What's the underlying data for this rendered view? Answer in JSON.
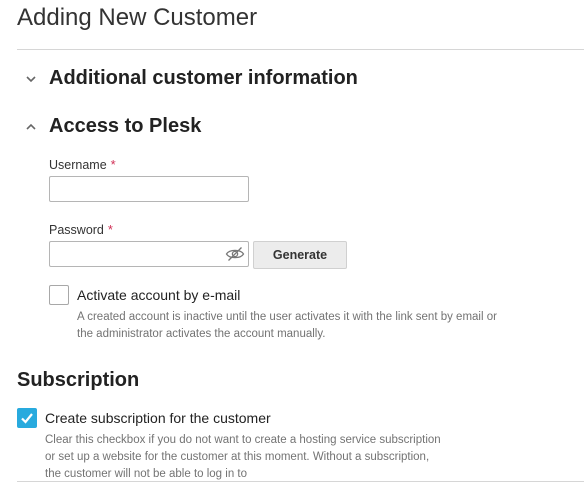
{
  "page": {
    "title": "Adding New Customer"
  },
  "sections": {
    "additional": {
      "label": "Additional customer information",
      "expanded": false,
      "icon": "chevron-down-icon"
    },
    "access": {
      "label": "Access to Plesk",
      "expanded": true,
      "icon": "chevron-up-icon"
    }
  },
  "access": {
    "username_label": "Username",
    "username_value": "",
    "password_label": "Password",
    "password_value": "",
    "required_mark": "*",
    "generate_label": "Generate",
    "activate_label": "Activate account by e-mail",
    "activate_checked": false,
    "activate_hint": "A created account is inactive until the user activates it with the link sent by email or the administrator activates the account manually."
  },
  "subscription": {
    "title": "Subscription",
    "checkbox_label": "Create subscription for the customer",
    "checked": true,
    "hint": "Clear this checkbox if you do not want to create a hosting service subscription or set up a website for the customer at this moment. Without a subscription, the customer will not be able to log in to"
  },
  "colors": {
    "accent": "#28aade",
    "required": "#d02e54",
    "hint_text": "#737373"
  }
}
